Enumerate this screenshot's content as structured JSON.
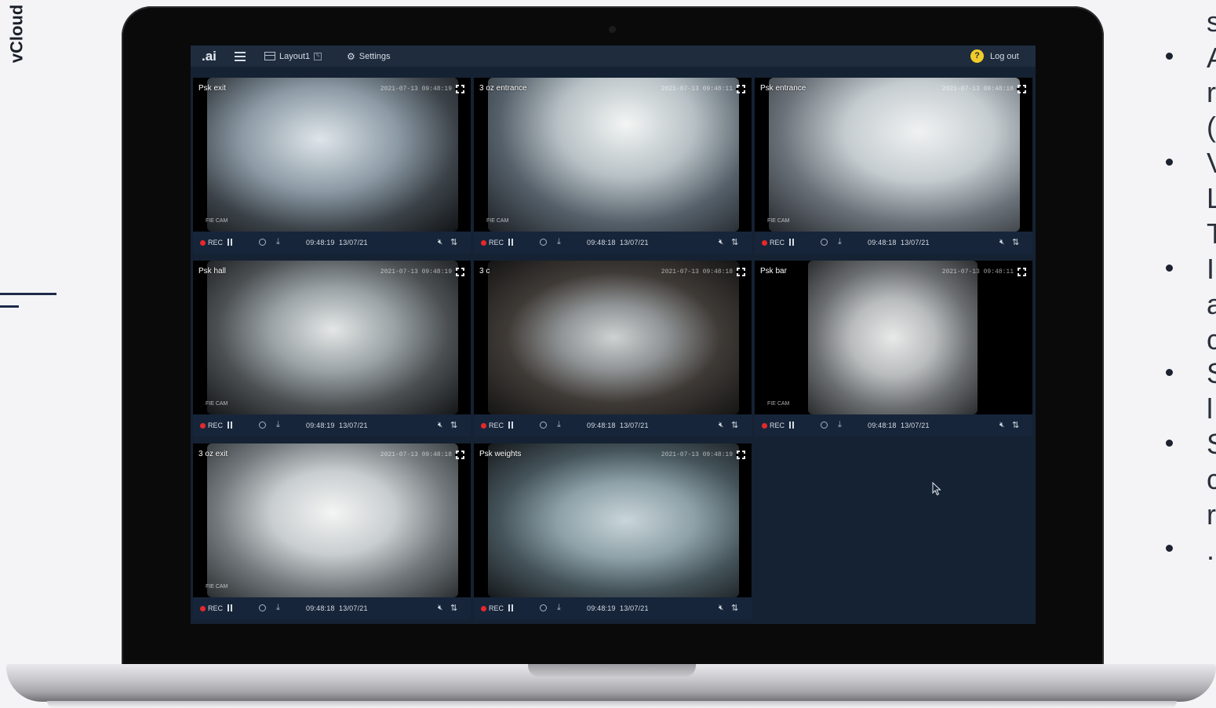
{
  "slide": {
    "brand": "vCloud",
    "right_text_fragments": [
      "s",
      "A",
      "r",
      "(",
      "V",
      "L",
      "T",
      "I",
      "a",
      "c",
      "S",
      "l",
      "S",
      "c",
      "r",
      "."
    ]
  },
  "app": {
    "logo": ".ai",
    "layout_label": "Layout1",
    "settings_label": "Settings",
    "logout_label": "Log out",
    "help_symbol": "?"
  },
  "cameras": [
    {
      "name": "Psk exit",
      "rec": "REC",
      "time": "09:48:19",
      "date": "13/07/21",
      "overlay": "2021-07-13 09:48:19",
      "tag": "FIE CAM"
    },
    {
      "name": "3 oz entrance",
      "rec": "REC",
      "time": "09:48:18",
      "date": "13/07/21",
      "overlay": "2021-07-13 09:48:11",
      "tag": "FIE CAM"
    },
    {
      "name": "Psk entrance",
      "rec": "REC",
      "time": "09:48:18",
      "date": "13/07/21",
      "overlay": "2021-07-13 09:48:18",
      "tag": "FIE CAM"
    },
    {
      "name": "Psk hall",
      "rec": "REC",
      "time": "09:48:19",
      "date": "13/07/21",
      "overlay": "2021-07-13 09:48:19",
      "tag": "FIE CAM"
    },
    {
      "name": "3 c",
      "rec": "REC",
      "time": "09:48:18",
      "date": "13/07/21",
      "overlay": "2021-07-13 09:48:18",
      "tag": ""
    },
    {
      "name": "Psk bar",
      "rec": "REC",
      "time": "09:48:18",
      "date": "13/07/21",
      "overlay": "2021-07-13 09:48:11",
      "tag": "FIE CAM"
    },
    {
      "name": "3 oz exit",
      "rec": "REC",
      "time": "09:48:18",
      "date": "13/07/21",
      "overlay": "2021-07-13 09:48:18",
      "tag": "FIE CAM"
    },
    {
      "name": "Psk weights",
      "rec": "REC",
      "time": "09:48:19",
      "date": "13/07/21",
      "overlay": "2021-07-13 09:48:19",
      "tag": ""
    }
  ],
  "colors": {
    "rec_dot": "#e5282b",
    "help_badge": "#f1cc2a",
    "screen_bg": "#152233",
    "topbar_bg": "#1e2c3e"
  }
}
